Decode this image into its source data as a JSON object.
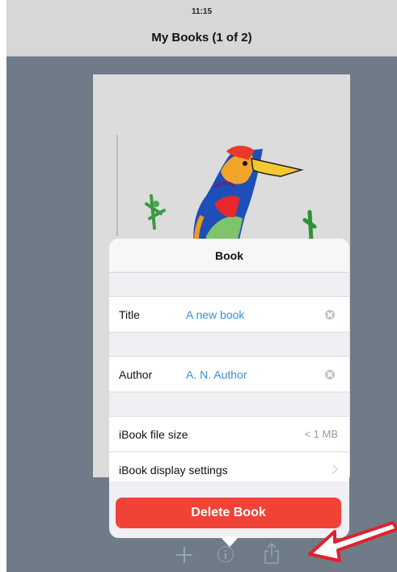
{
  "status_bar": {
    "time": "11:15"
  },
  "nav_bar": {
    "title": "My Books (1 of 2)"
  },
  "popover": {
    "title": "Book",
    "fields": {
      "title_label": "Title",
      "title_value": "A new book",
      "author_label": "Author",
      "author_value": "A. N. Author"
    },
    "details": {
      "file_size_label": "iBook file size",
      "file_size_value": "< 1 MB",
      "display_settings_label": "iBook display settings"
    },
    "delete_label": "Delete Book"
  },
  "toolbar": {
    "icons": [
      "add-icon",
      "info-icon",
      "share-icon"
    ],
    "icon_color": "#8ea6bf"
  },
  "colors": {
    "workspace": "#6f7b86",
    "accent_link": "#3b8fd9",
    "destructive": "#f04336",
    "annotation": "#e0212b"
  }
}
